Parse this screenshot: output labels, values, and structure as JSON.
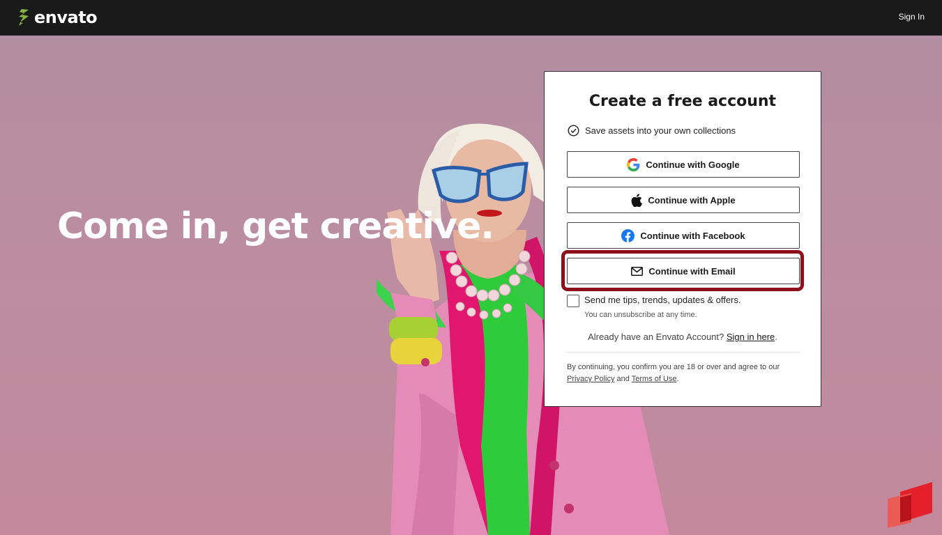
{
  "nav": {
    "logo_text": "envato",
    "sign_in": "Sign In"
  },
  "hero": {
    "headline": "Come in, get creative."
  },
  "card": {
    "title": "Create a free account",
    "benefit": "Save assets into your own collections",
    "buttons": {
      "google": "Continue with Google",
      "apple": "Continue with Apple",
      "facebook": "Continue with Facebook",
      "email": "Continue with Email"
    },
    "optin": {
      "label": "Send me tips, trends, updates & offers.",
      "note": "You can unsubscribe at any time.",
      "checked": false
    },
    "already": {
      "prefix": "Already have an Envato Account?",
      "link": "Sign in here",
      "suffix": "."
    },
    "legal": {
      "prefix": "By continuing, you confirm you are 18 or over and agree to our",
      "privacy": "Privacy Policy",
      "and": "and",
      "terms": "Terms of Use",
      "suffix": "."
    }
  },
  "colors": {
    "topbar": "#1a1a1a",
    "brand_green": "#82b541",
    "highlight": "#8e0f1a",
    "hero_bg": "#b88a9c",
    "facebook": "#1877f2"
  },
  "icons": {
    "logo": "envato-leaf-icon",
    "benefit": "check-circle-icon",
    "google": "google-g-icon",
    "apple": "apple-icon",
    "facebook": "facebook-icon",
    "email": "envelope-icon",
    "watermark": "red-logo-icon"
  }
}
